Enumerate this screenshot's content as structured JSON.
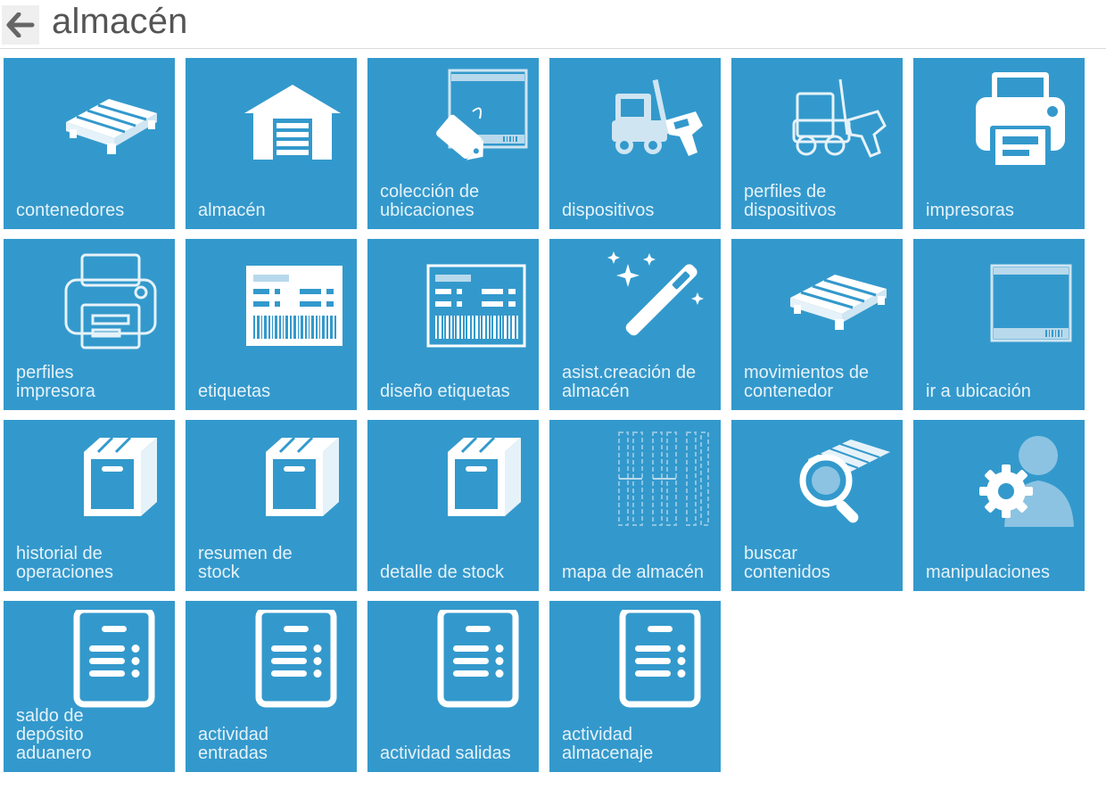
{
  "header": {
    "title": "almacén",
    "back_icon": "arrow-left-icon"
  },
  "colors": {
    "tile_bg": "#3399cc",
    "tile_text": "#e6f2f9",
    "title_text": "#555555",
    "back_bg": "#efefef"
  },
  "tiles": [
    {
      "label": "contenedores",
      "icon": "pallet-icon"
    },
    {
      "label": "almacén",
      "icon": "warehouse-icon"
    },
    {
      "label": "colección de\nubicaciones",
      "icon": "location-tag-icon"
    },
    {
      "label": "dispositivos",
      "icon": "forklift-scanner-icon"
    },
    {
      "label": "perfiles de\ndispositivos",
      "icon": "forklift-scanner-outline-icon"
    },
    {
      "label": "impresoras",
      "icon": "printer-icon"
    },
    {
      "label": "perfiles\nimpresora",
      "icon": "printer-outline-icon"
    },
    {
      "label": "etiquetas",
      "icon": "barcode-label-icon"
    },
    {
      "label": "diseño etiquetas",
      "icon": "barcode-label-outline-icon"
    },
    {
      "label": "asist.creación de\nalmacén",
      "icon": "magic-wand-icon"
    },
    {
      "label": "movimientos de\ncontenedor",
      "icon": "pallet-move-icon"
    },
    {
      "label": "ir a ubicación",
      "icon": "location-frame-icon"
    },
    {
      "label": "historial de\noperaciones",
      "icon": "box-icon"
    },
    {
      "label": "resumen de\nstock",
      "icon": "box-icon"
    },
    {
      "label": "detalle de stock",
      "icon": "box-icon"
    },
    {
      "label": "mapa de almacén",
      "icon": "warehouse-map-icon"
    },
    {
      "label": "buscar\ncontenidos",
      "icon": "search-pallet-icon"
    },
    {
      "label": "manipulaciones",
      "icon": "user-gear-icon"
    },
    {
      "label": "saldo de\ndepósito\naduanero",
      "icon": "document-list-icon"
    },
    {
      "label": "actividad\nentradas",
      "icon": "document-list-icon"
    },
    {
      "label": "actividad salidas",
      "icon": "document-list-icon"
    },
    {
      "label": "actividad\nalmacenaje",
      "icon": "document-list-icon"
    }
  ]
}
